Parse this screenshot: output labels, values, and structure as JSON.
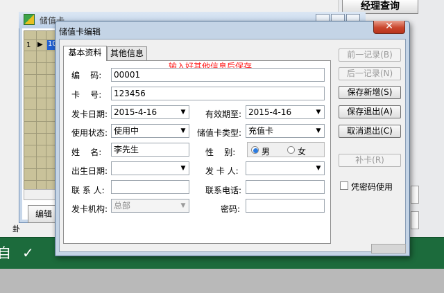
{
  "background": {
    "manager_button": "经理查询",
    "back_window_title": "储值卡",
    "grid_row_number": "1",
    "grid_row_pointer": "▶",
    "grid_cell_value": "10",
    "edit_button": "编辑",
    "left_stub_label": "卦",
    "taskbar_icon1": "自",
    "taskbar_icon2": "✓"
  },
  "dialog": {
    "title": "储值卡编辑",
    "close_symbol": "✕",
    "hint": "输入好其他信息后保存",
    "tabs": [
      {
        "label": "基本资料",
        "active": true
      },
      {
        "label": "其他信息",
        "active": false
      }
    ],
    "fields": {
      "code": {
        "label": "编    码:",
        "value": "00001"
      },
      "card_no": {
        "label": "卡    号:",
        "value": "123456"
      },
      "issue_date": {
        "label": "发卡日期:",
        "value": "2015-4-16"
      },
      "expiry": {
        "label": "有效期至:",
        "value": "2015-4-16"
      },
      "status": {
        "label": "使用状态:",
        "value": "使用中"
      },
      "card_type": {
        "label": "储值卡类型:",
        "value": "充值卡"
      },
      "name": {
        "label": "姓    名:",
        "value": "李先生"
      },
      "gender": {
        "label": "性    别:",
        "options": [
          "男",
          "女"
        ],
        "selected": "男"
      },
      "birth_date": {
        "label": "出生日期:",
        "value": ""
      },
      "issuer": {
        "label": "发 卡 人:",
        "value": ""
      },
      "contact": {
        "label": "联 系 人:",
        "value": ""
      },
      "phone": {
        "label": "联系电话:",
        "value": ""
      },
      "org": {
        "label": "发卡机构:",
        "value": "总部"
      },
      "password": {
        "label": "密码:",
        "value": ""
      }
    },
    "buttons": {
      "prev": "前一记录(B)",
      "next": "后一记录(N)",
      "save_new": "保存新增(S)",
      "save_exit": "保存退出(A)",
      "cancel_exit": "取消退出(C)",
      "reissue": "补卡(R)"
    },
    "password_checkbox": {
      "label": "凭密码使用",
      "checked": false
    },
    "dropdown_arrow": "▼"
  }
}
